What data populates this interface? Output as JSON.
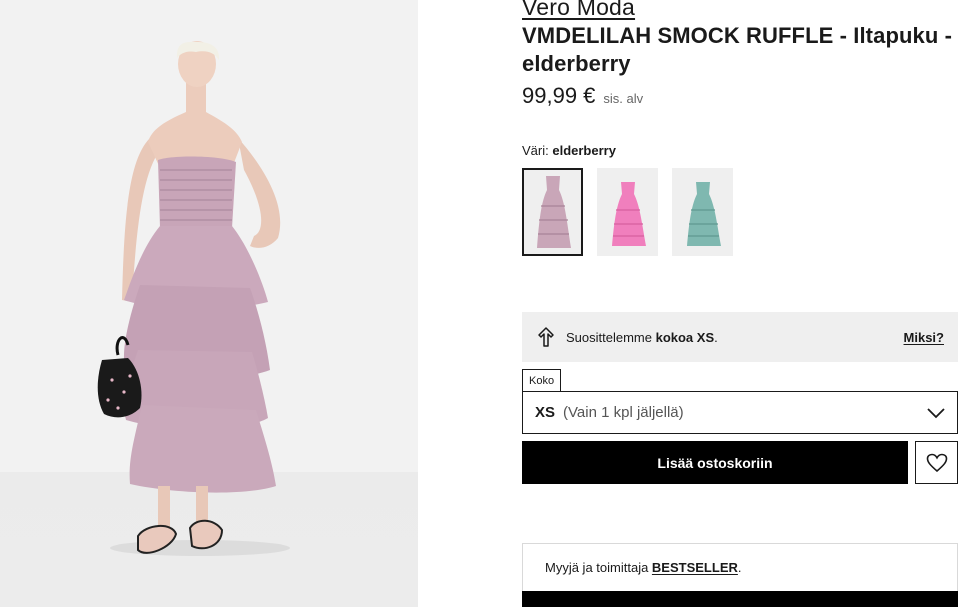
{
  "product": {
    "brand": "Vero Moda",
    "title": "VMDELILAH SMOCK RUFFLE - Iltapuku - elderberry",
    "price": "99,99 €",
    "vat_note": "sis. alv"
  },
  "color": {
    "label": "Väri:",
    "selected": "elderberry",
    "swatches": [
      {
        "name": "elderberry",
        "color": "#c9a6b8"
      },
      {
        "name": "pink",
        "color": "#f07fbd"
      },
      {
        "name": "teal",
        "color": "#7fb8b0"
      }
    ]
  },
  "size_recommendation": {
    "text_prefix": "Suosittelemme ",
    "size_text": "kokoa XS",
    "text_suffix": ".",
    "why_link": "Miksi?"
  },
  "size_select": {
    "label": "Koko",
    "selected_size": "XS",
    "availability": "(Vain 1 kpl jäljellä)"
  },
  "actions": {
    "add_to_cart": "Lisää ostoskoriin"
  },
  "seller": {
    "prefix": "Myyjä ja toimittaja ",
    "name": "BESTSELLER",
    "suffix": "."
  },
  "colors": {
    "accent": "#000000",
    "panel_bg": "#efefef",
    "dress": "#c6a8b8"
  }
}
